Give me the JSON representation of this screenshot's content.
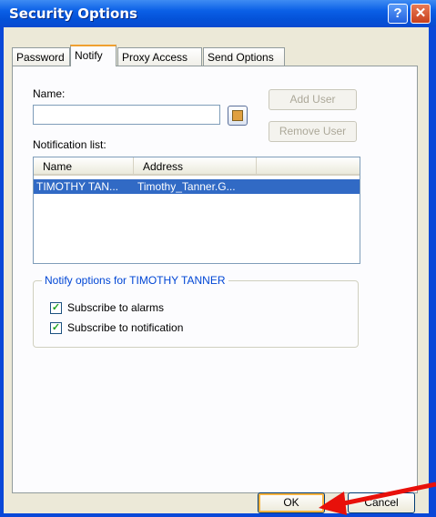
{
  "window": {
    "title": "Security Options",
    "help_glyph": "?",
    "close_glyph": "✕"
  },
  "tabs": [
    {
      "label": "Password",
      "active": false
    },
    {
      "label": "Notify",
      "active": true
    },
    {
      "label": "Proxy Access",
      "active": false
    },
    {
      "label": "Send Options",
      "active": false
    }
  ],
  "notify": {
    "name_label": "Name:",
    "name_value": "",
    "add_user": "Add User",
    "remove_user": "Remove User",
    "list_label": "Notification list:",
    "columns": [
      "Name",
      "Address"
    ],
    "rows": [
      {
        "name": "TIMOTHY TAN...",
        "address": "Timothy_Tanner.G..."
      }
    ],
    "options_legend": "Notify options for TIMOTHY TANNER",
    "options": [
      {
        "label": "Subscribe to alarms",
        "checked": true
      },
      {
        "label": "Subscribe to notification",
        "checked": true
      }
    ]
  },
  "footer": {
    "ok": "OK",
    "cancel": "Cancel"
  },
  "colors": {
    "title_bar": "#0a5fe6",
    "selection": "#316ac5",
    "annotation_arrow": "#e8100a"
  }
}
